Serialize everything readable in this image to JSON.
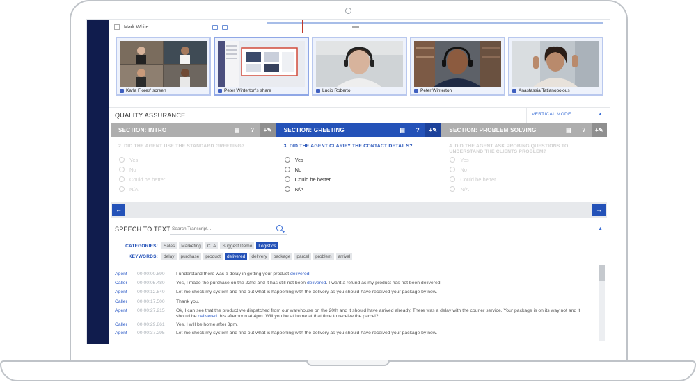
{
  "participant": {
    "name": "Mark White"
  },
  "tiles": [
    {
      "label": "Karla Flores' screen"
    },
    {
      "label": "Peter Winterton's share"
    },
    {
      "label": "Lucio Roberto"
    },
    {
      "label": "Peter Winterton"
    },
    {
      "label": "Anastassia Tatianopolous"
    }
  ],
  "qa": {
    "title": "QUALITY ASSURANCE",
    "mode_button": "VERTICAL MODE",
    "sections": [
      {
        "title": "SECTION: INTRO",
        "question": "2. DID THE AGENT USE THE STANDARD GREETING?",
        "options": [
          "Yes",
          "No",
          "Could be better",
          "N/A"
        ]
      },
      {
        "title": "SECTION: GREETING",
        "question": "3. DID THE AGENT CLARIFY THE CONTACT DETAILS?",
        "options": [
          "Yes",
          "No",
          "Could be better",
          "N/A"
        ]
      },
      {
        "title": "SECTION: PROBLEM SOLVING",
        "question": "4. DID THE AGENT ASK PROBING QUESTIONS TO UNDERSTAND THE CLIENTS PROBLEM?",
        "options": [
          "Yes",
          "No",
          "Could be better",
          "N/A"
        ]
      }
    ],
    "tool_help": "?",
    "tool_add": "+"
  },
  "stt": {
    "title": "SPEECH TO TEXT",
    "search_placeholder": "Search Transcript...",
    "categories_label": "CATEGORIES:",
    "categories": [
      "Sales",
      "Marketing",
      "CTA",
      "Suggest Demo",
      "Logistics"
    ],
    "keywords_label": "KEYWORDS:",
    "keywords": [
      "delay",
      "purchase",
      "product",
      "delivered",
      "delivery",
      "package",
      "parcel",
      "problem",
      "arrival"
    ],
    "transcript": [
      {
        "speaker": "Agent",
        "time": "00:00:00.890",
        "pre": "I understand there was a delay in getting your product ",
        "hl": "delivered",
        "post": "."
      },
      {
        "speaker": "Caller",
        "time": "00:00:05.480",
        "pre": "Yes, I made the purchase on the 22nd and it has still not been ",
        "hl": "delivered",
        "post": ". I want a refund as my product has not been delivered."
      },
      {
        "speaker": "Agent",
        "time": "00:00:12.840",
        "pre": "Let me check my system and find out what is happening with the delivery as you should have received your package by now.",
        "hl": "",
        "post": ""
      },
      {
        "speaker": "Caller",
        "time": "00:00:17.500",
        "pre": "Thank you.",
        "hl": "",
        "post": ""
      },
      {
        "speaker": "Agent",
        "time": "00:00:27.215",
        "pre": "Ok, I can see that the product we dispatched from our warehouse on the 20th and it should have arrived already. There was a delay with the courier service. Your package is on its way not and it should be ",
        "hl": "delivered",
        "post": " this afternoon at 4pm. Will you be at home at that time to receive the parcel?"
      },
      {
        "speaker": "Caller",
        "time": "00:00:29.861",
        "pre": "Yes, I will be home after 3pm.",
        "hl": "",
        "post": ""
      },
      {
        "speaker": "Agent",
        "time": "00:00:37.295",
        "pre": "Let me check my system and find out what is happening with the delivery as you should have received your package by now.",
        "hl": "",
        "post": ""
      }
    ]
  },
  "colors": {
    "accent": "#2452b8",
    "sidebar": "#101c4d",
    "inactive_header": "#aeaeae"
  }
}
